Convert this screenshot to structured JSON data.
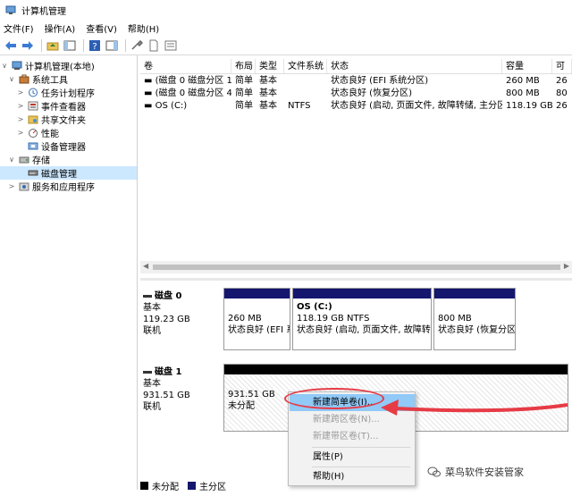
{
  "window": {
    "title": "计算机管理"
  },
  "menu": [
    "文件(F)",
    "操作(A)",
    "查看(V)",
    "帮助(H)"
  ],
  "tree": {
    "root": "计算机管理(本地)",
    "system_tools": "系统工具",
    "task_scheduler": "任务计划程序",
    "event_viewer": "事件查看器",
    "shared_folders": "共享文件夹",
    "performance": "性能",
    "device_manager": "设备管理器",
    "storage": "存储",
    "disk_management": "磁盘管理",
    "services_apps": "服务和应用程序"
  },
  "volume_table": {
    "headers": [
      "卷",
      "布局",
      "类型",
      "文件系统",
      "状态",
      "容量",
      "可"
    ],
    "rows": [
      [
        "(磁盘 0 磁盘分区 1)",
        "简单",
        "基本",
        "",
        "状态良好 (EFI 系统分区)",
        "260 MB",
        "26"
      ],
      [
        "(磁盘 0 磁盘分区 4)",
        "简单",
        "基本",
        "",
        "状态良好 (恢复分区)",
        "800 MB",
        "80"
      ],
      [
        "OS (C:)",
        "简单",
        "基本",
        "NTFS",
        "状态良好 (启动, 页面文件, 故障转储, 主分区)",
        "118.19 GB",
        "26"
      ]
    ]
  },
  "disk0": {
    "name": "磁盘 0",
    "type": "基本",
    "size": "119.23 GB",
    "status": "联机",
    "partitions": [
      {
        "title": "",
        "size": "260 MB",
        "status": "状态良好 (EFI 系"
      },
      {
        "title": "OS  (C:)",
        "size": "118.19 GB NTFS",
        "status": "状态良好 (启动, 页面文件, 故障转"
      },
      {
        "title": "",
        "size": "800 MB",
        "status": "状态良好 (恢复分区"
      }
    ]
  },
  "disk1": {
    "name": "磁盘 1",
    "type": "基本",
    "size": "931.51 GB",
    "status": "联机",
    "partition": {
      "size": "931.51 GB",
      "status": "未分配"
    }
  },
  "context_menu": {
    "new_simple": "新建简单卷(I)...",
    "new_spanned": "新建跨区卷(N)...",
    "new_striped": "新建带区卷(T)...",
    "properties": "属性(P)",
    "help": "帮助(H)"
  },
  "legend": {
    "unallocated": "未分配",
    "primary": "主分区"
  },
  "colors": {
    "primary_partition": "#15166e",
    "unallocated": "#000000",
    "annotation": "#e63b45",
    "highlight": "#91c9f7"
  },
  "watermark": {
    "text": "菜鸟软件安装管家"
  }
}
